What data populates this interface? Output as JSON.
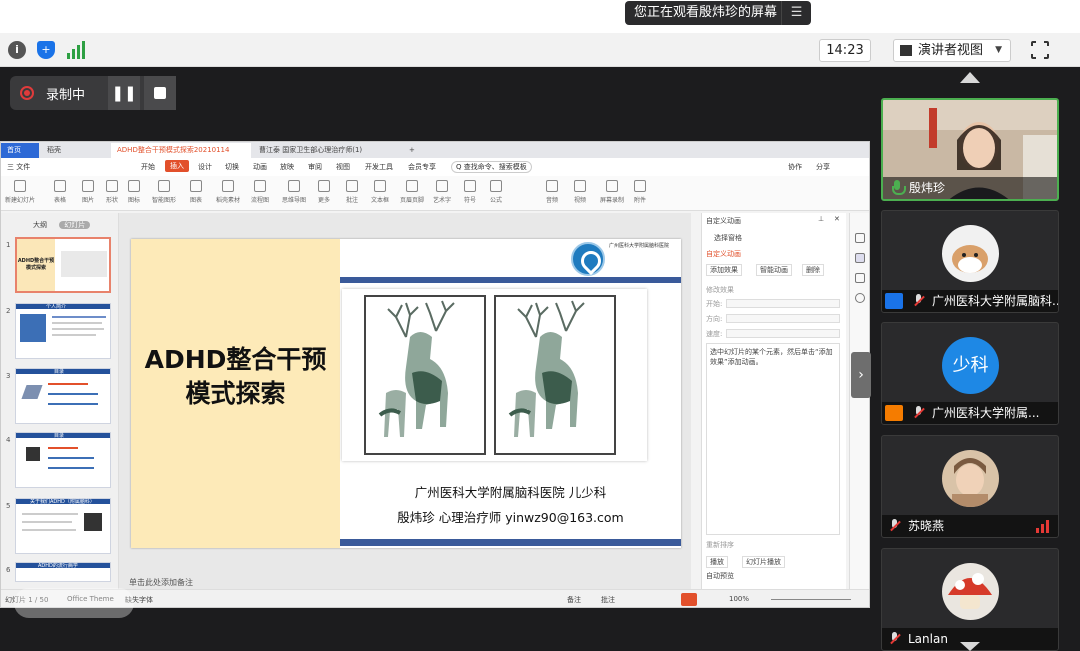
{
  "sharing_banner": {
    "text": "您正在观看殷炜珍的屏幕",
    "menu_icon": "list-menu-icon"
  },
  "toolbar": {
    "time": "14:23",
    "view_mode": "演讲者视图"
  },
  "recording": {
    "label": "录制中",
    "pause_glyph": "❚❚"
  },
  "wps": {
    "tabs": [
      {
        "label": "首页"
      },
      {
        "label": "稻壳"
      },
      {
        "label": "ADHD整合干预模式探索20210114"
      },
      {
        "label": "曹江泰 国家卫生部心理治疗师(1)"
      }
    ],
    "menu": [
      "三 文件",
      "开始",
      "插入",
      "设计",
      "切换",
      "动画",
      "放映",
      "审阅",
      "视图",
      "开发工具",
      "会员专享",
      "Q 查找命令、搜索模板"
    ],
    "menu_right": [
      "协作",
      "分享"
    ],
    "ribbon": [
      "新建幻灯片",
      "表格",
      "图片",
      "形状",
      "图标",
      "智能图形",
      "图表",
      "稻壳素材",
      "流程图",
      "思维导图",
      "更多",
      "批注",
      "文本框",
      "页眉页脚",
      "艺术字",
      "符号",
      "公式",
      "音频",
      "视频",
      "屏幕录制",
      "附件"
    ],
    "thumb_header": {
      "outline": "大纲",
      "slides": "幻灯片"
    },
    "thumbs": [
      {
        "num": "1",
        "title": "ADHD整合干预模式探索"
      },
      {
        "num": "2",
        "title": "个人简介"
      },
      {
        "num": "3",
        "title": "目录"
      },
      {
        "num": "4",
        "title": "目录"
      },
      {
        "num": "5",
        "title": "关于我们ADHD（附属脑科）"
      },
      {
        "num": "6",
        "title": "ADHD的流行病学"
      }
    ],
    "slide": {
      "title_line1": "ADHD整合干预",
      "title_line2": "模式探索",
      "logo_text": "广州医科大学附属脑科医院",
      "affiliation": "广州医科大学附属脑科医院  儿少科",
      "author": "殷炜珍  心理治疗师  yinwz90@163.com"
    },
    "notes_placeholder": "单击此处添加备注",
    "panel": {
      "title": "自定义动画",
      "select_pane": "选择窗格",
      "custom_anim": "自定义动画",
      "add_effect": "添加效果",
      "smart_anim": "智能动画",
      "delete": "删除",
      "modify_effect": "修改效果",
      "start": "开始:",
      "direction": "方向:",
      "speed": "速度:",
      "description": "选中幻灯片的某个元素，然后单击“添加效果”添加动画。",
      "reorder": "重新排序",
      "play": "播放",
      "slideshow": "幻灯片播放",
      "autopreview": "自动预览"
    },
    "status": {
      "slide_info": "幻灯片 1 / 50",
      "theme": "Office Theme",
      "font": "缺失字体",
      "notes": "备注",
      "comment": "批注",
      "zoom": "100%"
    }
  },
  "participants": [
    {
      "name": "殷炜珍",
      "role": "presenter",
      "speaking": true
    },
    {
      "name": "广州医科大学附属脑科...",
      "badge_color": "#1a73e8",
      "avatar": "dog-photo"
    },
    {
      "name": "广州医科大学附属...",
      "badge_color": "#f57c00",
      "avatar_text": "少科",
      "avatar_color": "#1e88e5"
    },
    {
      "name": "苏晓燕",
      "avatar": "child-photo"
    },
    {
      "name": "Lanlan",
      "avatar": "mushroom-photo"
    }
  ]
}
